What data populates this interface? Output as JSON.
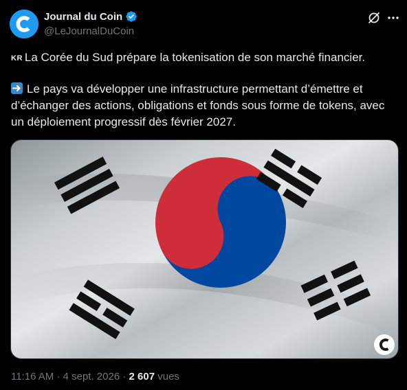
{
  "author": {
    "display_name": "Journal du Coin",
    "handle": "@LeJournalDuCoin",
    "verified": true,
    "avatar_color": "#1d9bf0"
  },
  "tweet": {
    "line1_flag": "KR",
    "line1_text": "La Corée du Sud prépare la tokenisation de son marché financier.",
    "line2_text": "Le pays va développer une infrastructure permettant d’émettre et d’échanger des actions, obligations et fonds sous forme de tokens, avec un déploiement progressif dès février 2027."
  },
  "media": {
    "description_icon": "south-korea-flag-image",
    "flag_colors": {
      "red": "#cd2e3a",
      "blue": "#0047a0",
      "black": "#111111",
      "white": "#d9dddf"
    }
  },
  "meta": {
    "time": "11:16 AM",
    "separator": "·",
    "date": "4 sept. 2026",
    "views_count": "2 607",
    "views_label": "vues"
  },
  "colors": {
    "background": "#000000",
    "text": "#e7e9ea",
    "secondary": "#71767b",
    "accent": "#1d9bf0"
  }
}
